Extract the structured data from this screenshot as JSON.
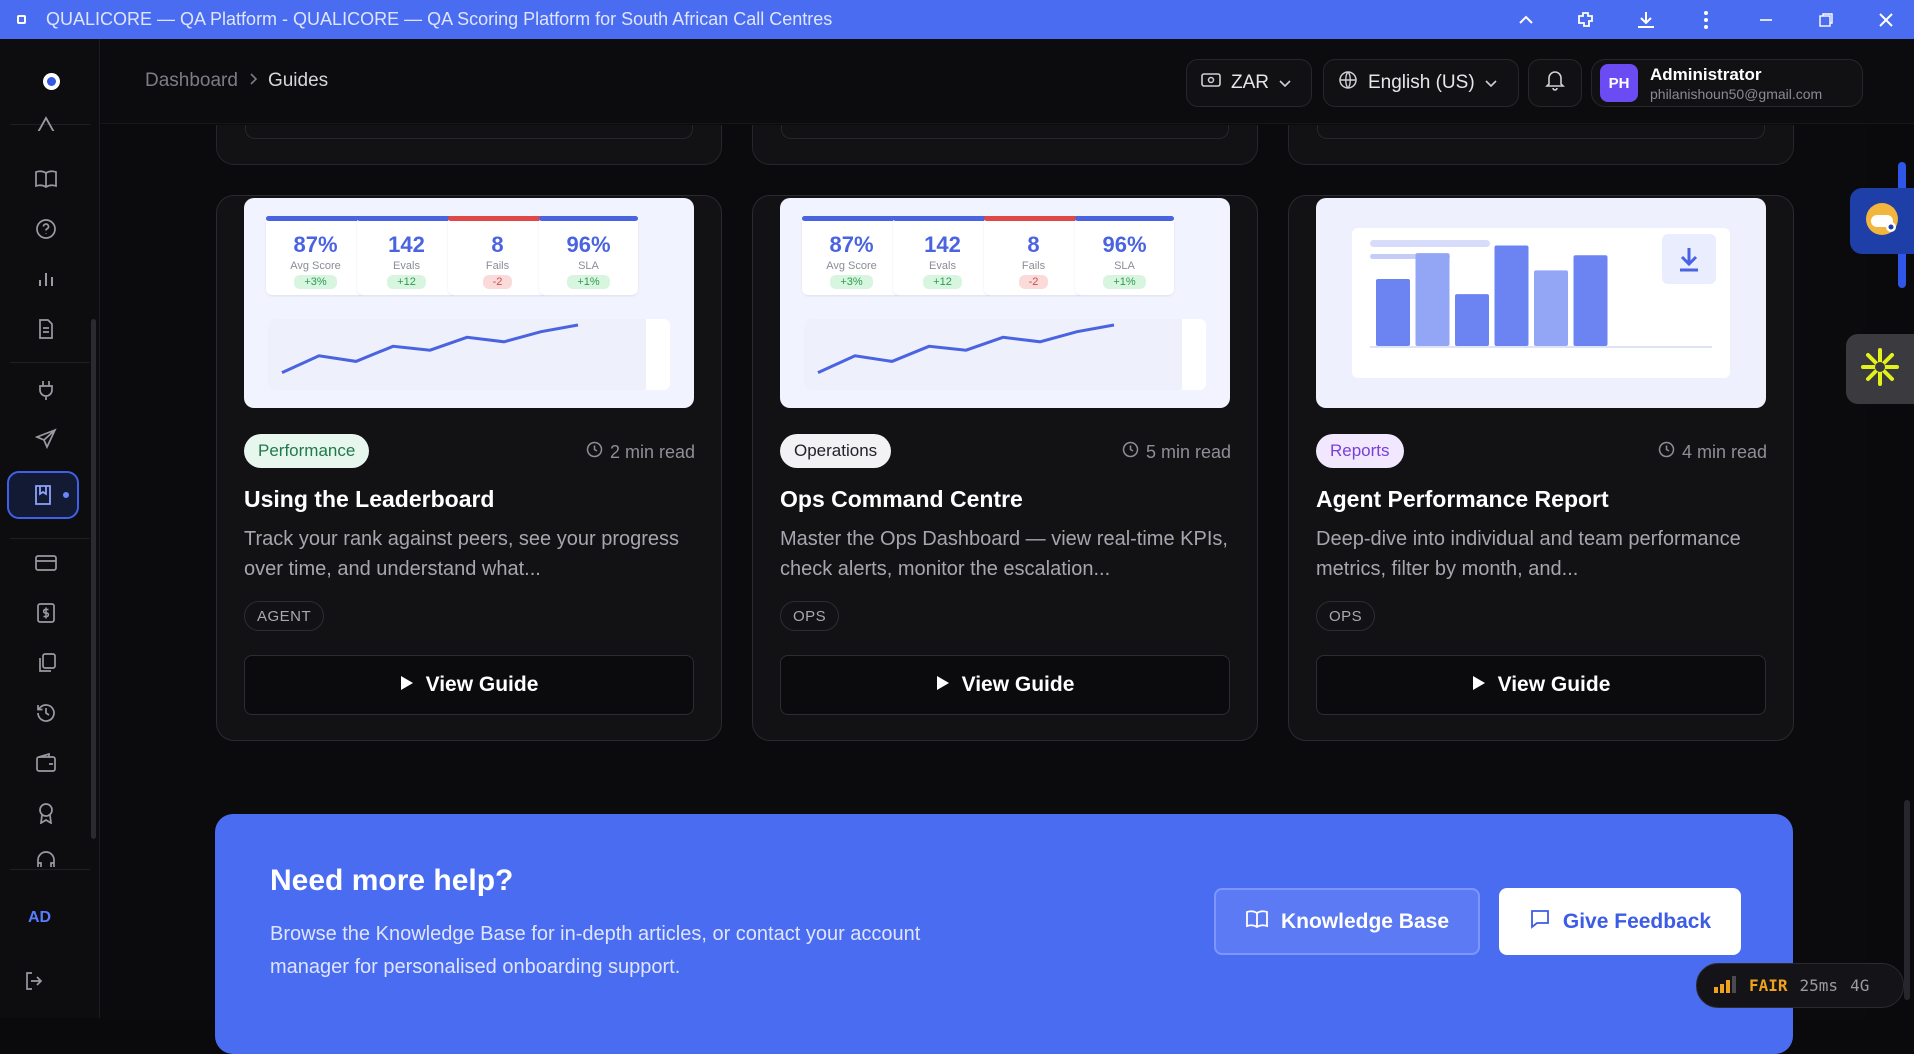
{
  "window": {
    "title": "QUALICORE — QA Platform - QUALICORE — QA Scoring Platform for South African Call Centres"
  },
  "header": {
    "breadcrumb": [
      "Dashboard",
      "Guides"
    ],
    "currency": "ZAR",
    "language": "English (US)",
    "user": {
      "initials": "PH",
      "name": "Administrator",
      "email": "philanishoun50@gmail.com"
    }
  },
  "sidebar": {
    "user_initials": "AD",
    "icons": [
      "alert-icon",
      "book-icon",
      "help-icon",
      "bar-chart-icon",
      "document-icon",
      "plug-icon",
      "send-icon",
      "guides-icon",
      "card-icon",
      "dollar-icon",
      "copy-icon",
      "history-icon",
      "wallet-icon",
      "award-icon",
      "headset-icon",
      "logout-icon"
    ]
  },
  "kpis": [
    {
      "value": "87%",
      "label": "Avg Score",
      "delta": "+3%",
      "trend": "pos",
      "color": "#4a63e0"
    },
    {
      "value": "142",
      "label": "Evals",
      "delta": "+12",
      "trend": "pos",
      "color": "#4a63e0"
    },
    {
      "value": "8",
      "label": "Fails",
      "delta": "-2",
      "trend": "neg",
      "color": "#e04848"
    },
    {
      "value": "96%",
      "label": "SLA",
      "delta": "+1%",
      "trend": "pos",
      "color": "#4a63e0"
    }
  ],
  "guides": [
    {
      "category": "Performance",
      "category_color": "#1f7a4a",
      "category_bg": "#e8f7ee",
      "read_time": "2 min read",
      "title": "Using the Leaderboard",
      "description": "Track your rank against peers, see your progress over time, and understand what...",
      "role": "AGENT",
      "button": "View Guide",
      "thumb": "dashboard"
    },
    {
      "category": "Operations",
      "category_color": "#22232a",
      "category_bg": "#f2f2f4",
      "read_time": "5 min read",
      "title": "Ops Command Centre",
      "description": "Master the Ops Dashboard — view real-time KPIs, check alerts, monitor the escalation...",
      "role": "OPS",
      "button": "View Guide",
      "thumb": "dashboard"
    },
    {
      "category": "Reports",
      "category_color": "#7a3fd6",
      "category_bg": "#f1e8ff",
      "read_time": "4 min read",
      "title": "Agent Performance Report",
      "description": "Deep-dive into individual and team performance metrics, filter by month, and...",
      "role": "OPS",
      "button": "View Guide",
      "thumb": "report"
    }
  ],
  "trend_line": [
    0.15,
    0.45,
    0.35,
    0.62,
    0.55,
    0.78,
    0.7,
    0.88,
    1.0
  ],
  "report_bars": [
    {
      "value": 0.62,
      "color": "#6b84f2"
    },
    {
      "value": 0.86,
      "color": "#93a6f5"
    },
    {
      "value": 0.48,
      "color": "#6b84f2"
    },
    {
      "value": 0.93,
      "color": "#6b84f2"
    },
    {
      "value": 0.7,
      "color": "#93a6f5"
    },
    {
      "value": 0.84,
      "color": "#6b84f2"
    }
  ],
  "help": {
    "title": "Need more help?",
    "text": "Browse the Knowledge Base for in-depth articles, or contact your account manager for personalised onboarding support.",
    "kb_button": "Knowledge Base",
    "feedback_button": "Give Feedback"
  },
  "network": {
    "quality": "FAIR",
    "latency": "25ms",
    "type": "4G"
  }
}
